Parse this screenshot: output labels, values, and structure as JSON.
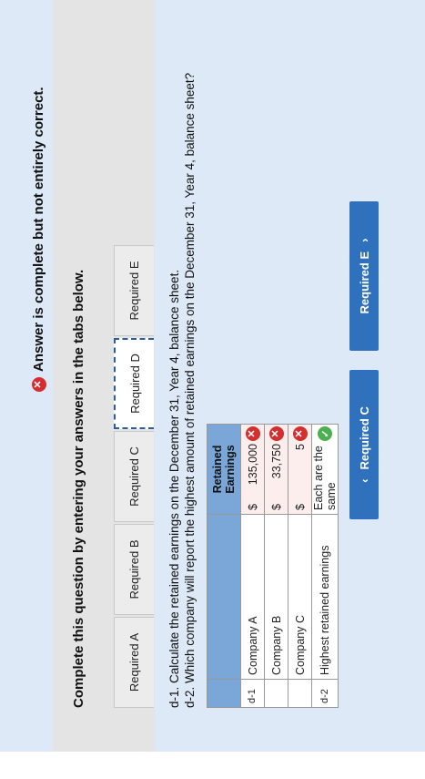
{
  "banner": {
    "message": "Answer is complete but not entirely correct."
  },
  "instructions": "Complete this question by entering your answers in the tabs below.",
  "tabs": [
    {
      "label": "Required A"
    },
    {
      "label": "Required B"
    },
    {
      "label": "Required C"
    },
    {
      "label": "Required D",
      "active": true
    },
    {
      "label": "Required E"
    }
  ],
  "questions": {
    "d1": "d-1. Calculate the retained earnings on the December 31, Year 4, balance sheet.",
    "d2": "d-2. Which company will report the highest amount of retained earnings on the December 31, Year 4, balance sheet?"
  },
  "table": {
    "header": "Retained Earnings",
    "rows": [
      {
        "id": "d-1",
        "name": "Company A",
        "currency": "$",
        "value": "135,000",
        "status": "incorrect"
      },
      {
        "id": "",
        "name": "Company B",
        "currency": "$",
        "value": "33,750",
        "status": "incorrect"
      },
      {
        "id": "",
        "name": "Company C",
        "currency": "$",
        "value": "5",
        "status": "incorrect"
      },
      {
        "id": "d-2",
        "name": "Highest retained earnings",
        "currency": "",
        "value": "Each are the same",
        "status": "correct"
      }
    ]
  },
  "nav": {
    "prev_label": "Required C",
    "next_label": "Required E",
    "prev_icon": "‹",
    "next_icon": "›"
  },
  "colors": {
    "banner_bg": "#dde9f6",
    "panel_bg": "#e4e4e4",
    "header_bg": "#7aa7d8",
    "button_bg": "#2f71bd",
    "error": "#d32f2f",
    "success": "#4caf50"
  }
}
